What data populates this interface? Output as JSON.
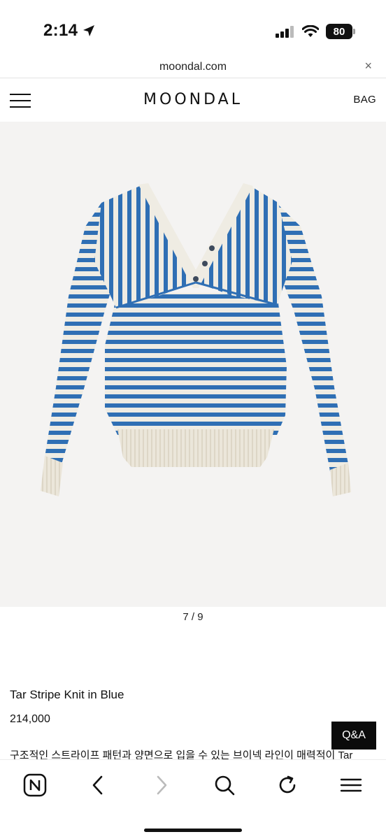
{
  "status_bar": {
    "time": "2:14",
    "battery": "80"
  },
  "url_bar": {
    "url": "moondal.com",
    "close_symbol": "×"
  },
  "header": {
    "logo": "MOONDAL",
    "bag_label": "BAG"
  },
  "gallery": {
    "pager": "7 / 9",
    "current": 7,
    "total": 9,
    "image_icon": "striped-sweater-image",
    "colors": {
      "stripe_blue": "#2f6fb4",
      "stripe_cream": "#efece3",
      "background": "#f4f3f2"
    }
  },
  "product": {
    "title": "Tar Stripe Knit in Blue",
    "price": "214,000",
    "description": "구조적인 스트라이프 패턴과 양면으로 입을 수 있는 브이넥 라인이 매력적이 Tar"
  },
  "qa_button": {
    "label": "Q&A"
  },
  "toolbar": {
    "icons": [
      "naver-home-icon",
      "back-icon",
      "forward-icon",
      "search-icon",
      "reload-icon",
      "menu-icon"
    ]
  }
}
